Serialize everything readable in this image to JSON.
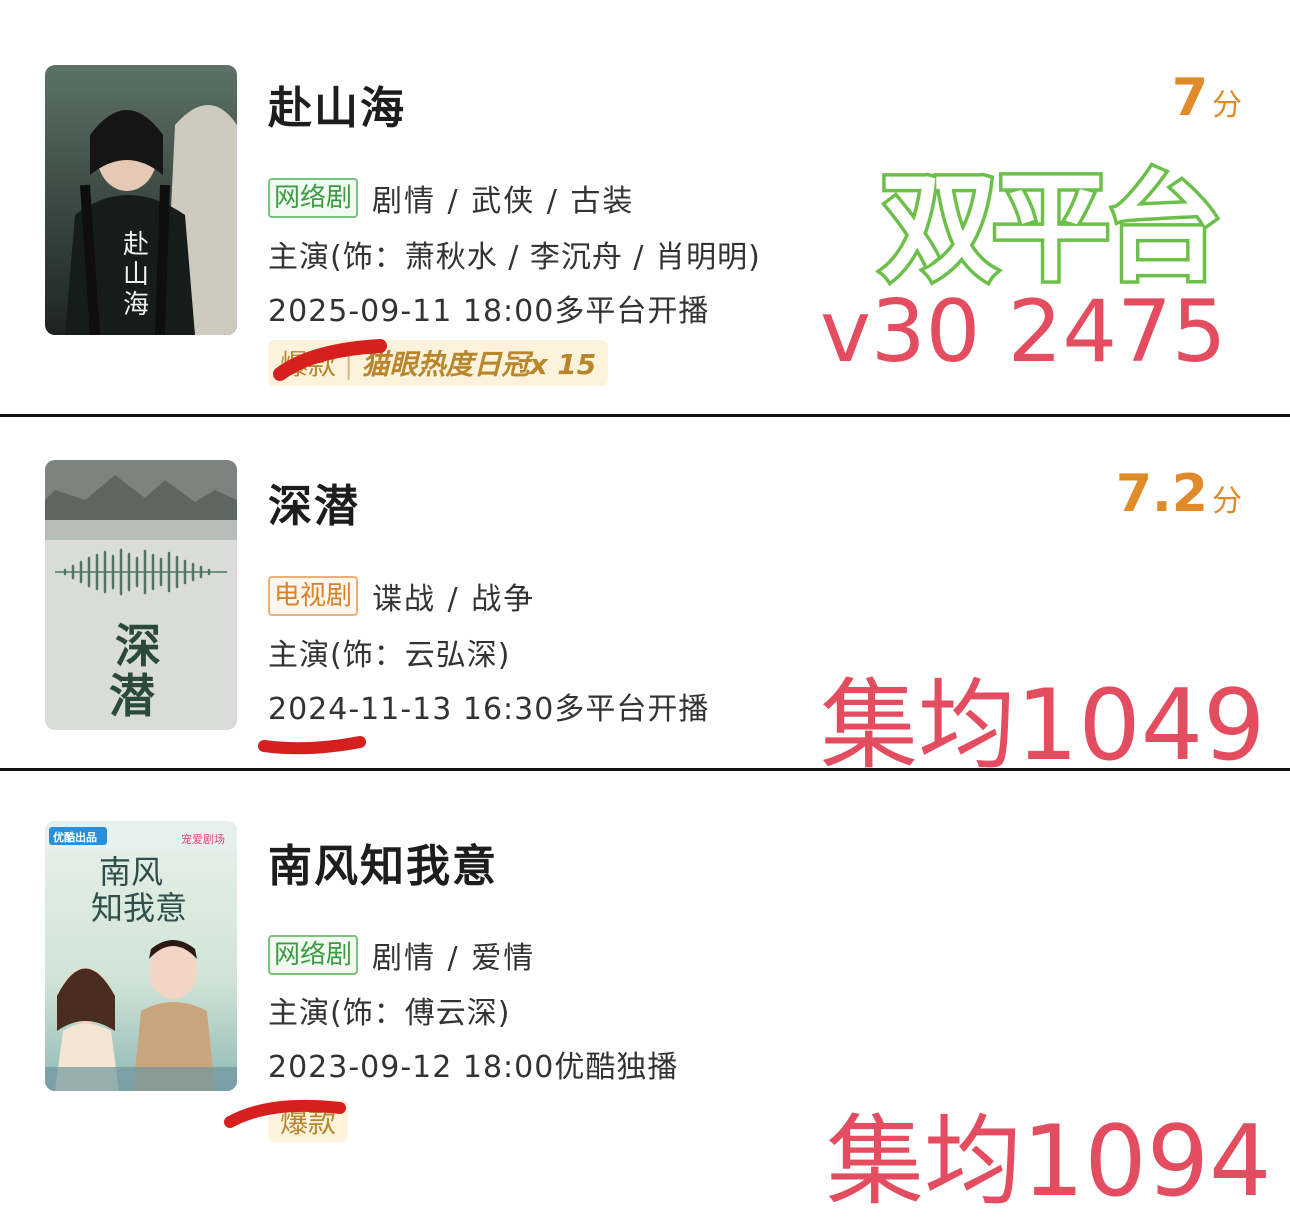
{
  "shows": [
    {
      "title": "赴山海",
      "tag": "网络剧",
      "genre": "剧情 / 武侠 / 古装",
      "cast": "主演(饰：萧秋水 / 李沉舟 / 肖明明)",
      "airing": "2025-09-11 18:00多平台开播",
      "score": "7",
      "score_unit": "分",
      "badge_left": "爆款",
      "badge_right": "猫眼热度日冠x 15",
      "poster_text": "赴山海"
    },
    {
      "title": "深潜",
      "tag": "电视剧",
      "genre": "谍战 / 战争",
      "cast": "主演(饰：云弘深)",
      "airing": "2024-11-13 16:30多平台开播",
      "score": "7.2",
      "score_unit": "分",
      "poster_text_1": "深",
      "poster_text_2": "潜"
    },
    {
      "title": "南风知我意",
      "tag": "网络剧",
      "genre": "剧情 / 爱情",
      "cast": "主演(饰：傅云深)",
      "airing": "2023-09-12 18:00优酷独播",
      "badge_left": "爆款",
      "poster_top_left": "优酷出品",
      "poster_top_right": "宠爱剧场",
      "poster_title_1": "南风",
      "poster_title_2": "知我意"
    }
  ],
  "annotations": {
    "dual_platform": "双平台",
    "v30": "v30 2475",
    "avg_1": "集均1049",
    "avg_2": "集均1094"
  }
}
